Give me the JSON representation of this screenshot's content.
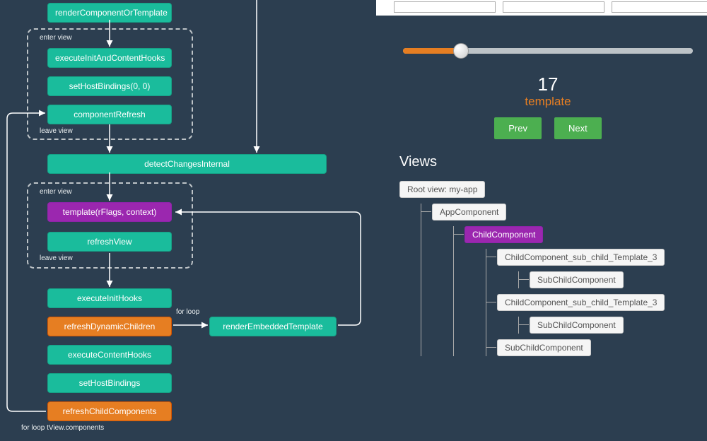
{
  "flow": {
    "renderComponentOrTemplate": "renderComponentOrTemplate",
    "group1": {
      "enter": "enter view",
      "leave": "leave view",
      "executeInitAndContentHooks": "executeInitAndContentHooks",
      "setHostBindings00": "setHostBindings(0, 0)",
      "componentRefresh": "componentRefresh"
    },
    "detectChangesInternal": "detectChangesInternal",
    "group2": {
      "enter": "enter view",
      "leave": "leave view",
      "templateFn": "template(rFlags, context)",
      "refreshView": "refreshView"
    },
    "executeInitHooks": "executeInitHooks",
    "refreshDynamicChildren": "refreshDynamicChildren",
    "forLoop": "for loop",
    "renderEmbeddedTemplate": "renderEmbeddedTemplate",
    "executeContentHooks": "executeContentHooks",
    "setHostBindings": "setHostBindings",
    "refreshChildComponents": "refreshChildComponents",
    "forLoopComponents": "for loop tView.components"
  },
  "controls": {
    "stepNum": "17",
    "stepLabel": "template",
    "prev": "Prev",
    "next": "Next",
    "sliderPercent": 20
  },
  "views": {
    "title": "Views",
    "root": "Root view: my-app",
    "app": "AppComponent",
    "child": "ChildComponent",
    "subTpl3a": "ChildComponent_sub_child_Template_3",
    "subChildA": "SubChildComponent",
    "subTpl3b": "ChildComponent_sub_child_Template_3",
    "subChildB": "SubChildComponent",
    "subChildC": "SubChildComponent"
  },
  "inputs": {
    "a": "",
    "b": "",
    "c": ""
  }
}
